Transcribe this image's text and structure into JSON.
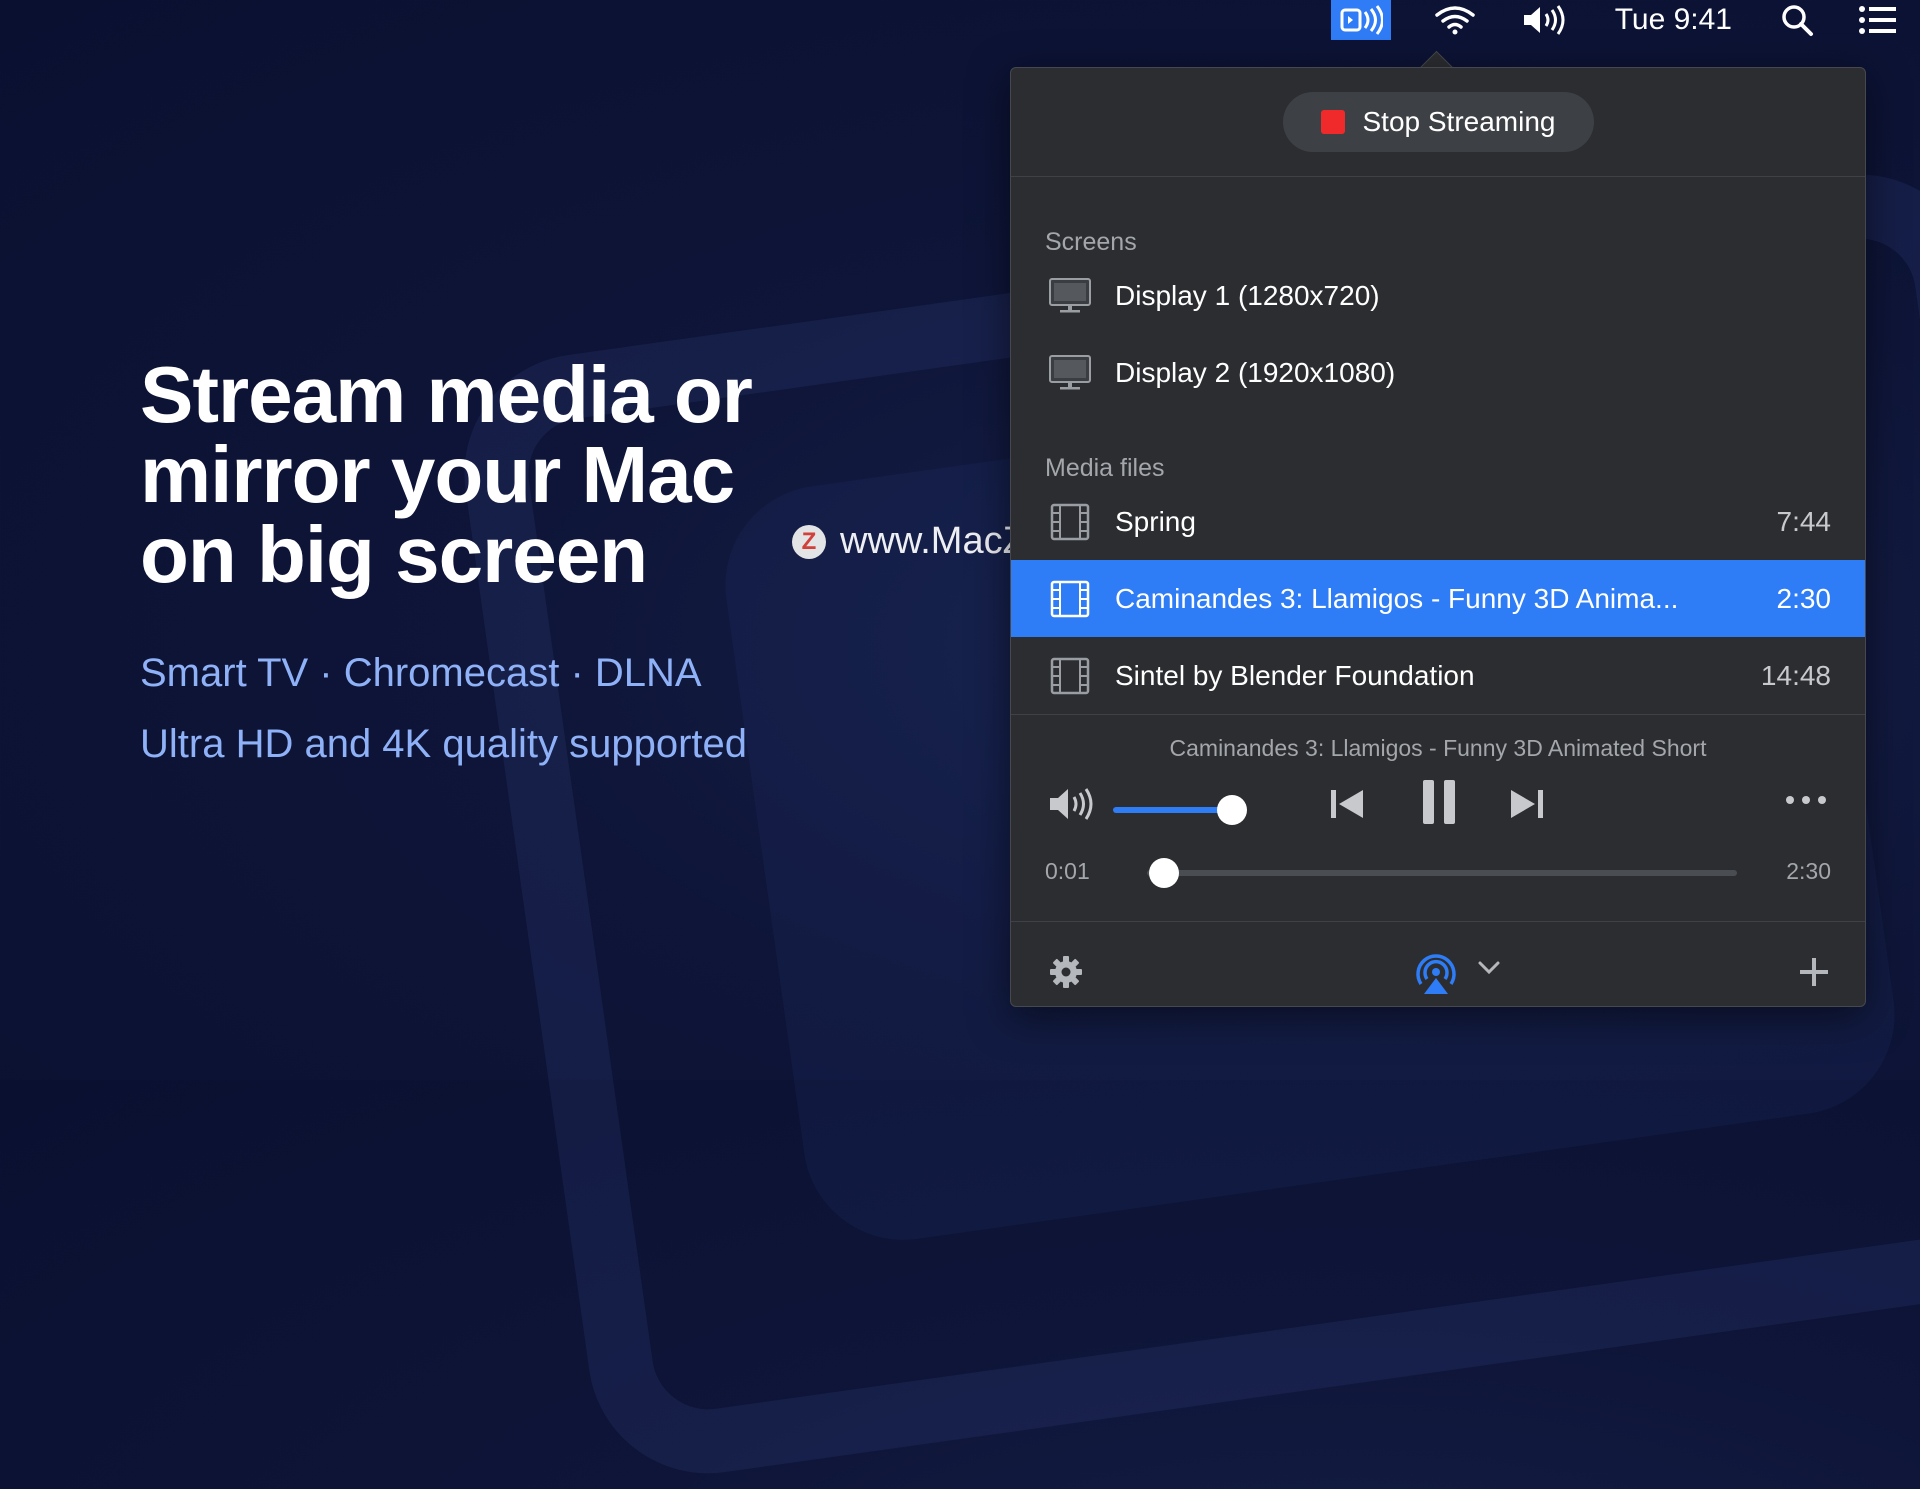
{
  "menubar": {
    "clock": "Tue 9:41",
    "icons": [
      "app-status-icon",
      "wifi-icon",
      "volume-icon",
      "search-icon",
      "list-icon"
    ]
  },
  "hero": {
    "title": "Stream media or\nmirror your Mac\non big screen",
    "sub1": "Smart TV · Chromecast · DLNA",
    "sub2": "Ultra HD and 4K quality supported"
  },
  "watermark": {
    "logo": "Z",
    "text": "www.MacZ.com"
  },
  "panel": {
    "stop_label": "Stop Streaming",
    "screens_label": "Screens",
    "screens": [
      {
        "label": "Display 1 (1280x720)"
      },
      {
        "label": "Display 2 (1920x1080)"
      }
    ],
    "media_label": "Media files",
    "media": [
      {
        "label": "Spring",
        "duration": "7:44"
      },
      {
        "label": "Caminandes 3: Llamigos - Funny 3D Anima...",
        "duration": "2:30",
        "selected": true
      },
      {
        "label": "Sintel by Blender Foundation",
        "duration": "14:48"
      }
    ],
    "player": {
      "now_playing": "Caminandes 3: Llamigos - Funny 3D Animated Short",
      "current_time": "0:01",
      "total_time": "2:30",
      "volume": 0.85,
      "progress": 0.007
    }
  },
  "colors": {
    "accent": "#2e7cf6",
    "stop": "#f02a2a",
    "hero_sub": "#8fb1f7"
  }
}
